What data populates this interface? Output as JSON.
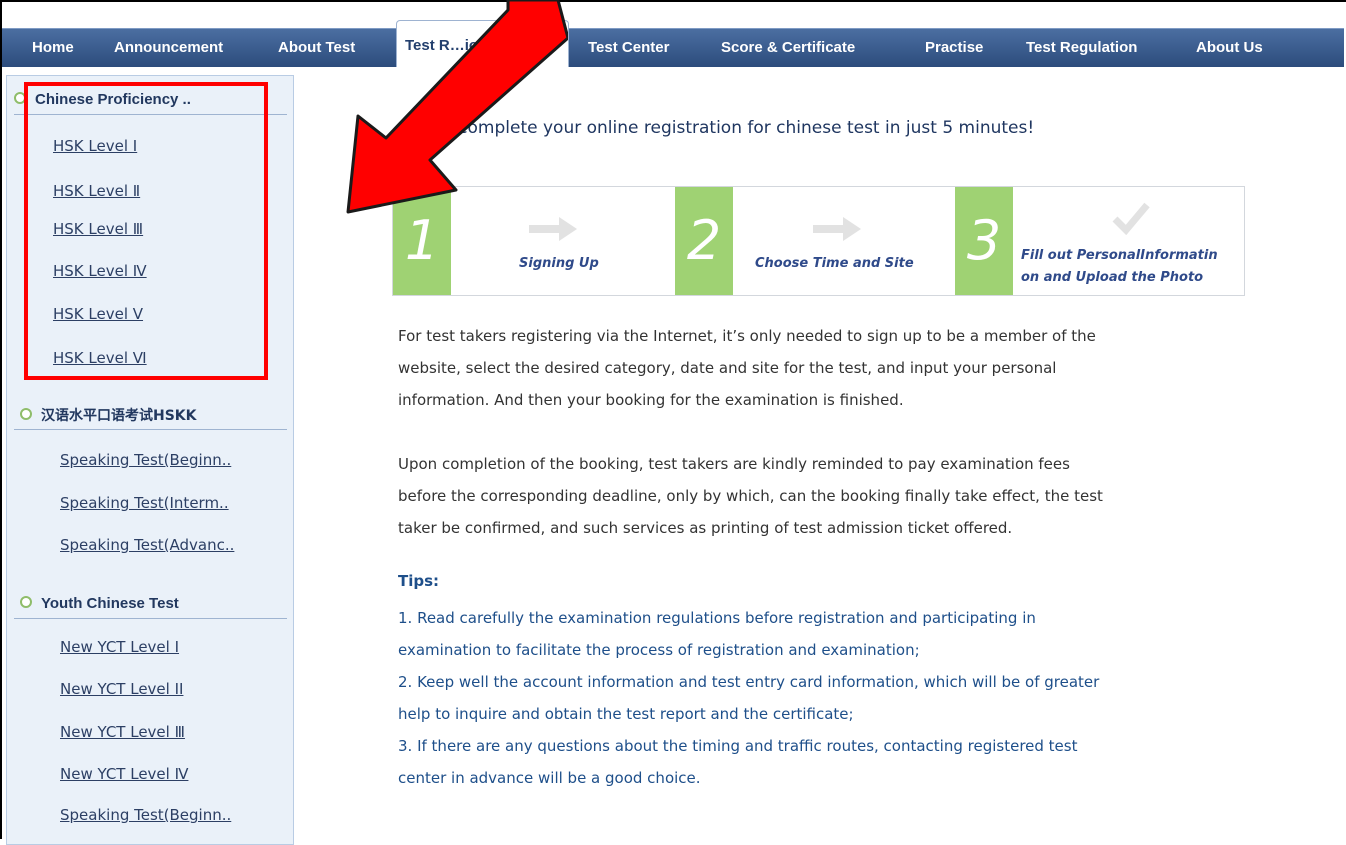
{
  "nav": {
    "items": [
      {
        "label": "Home"
      },
      {
        "label": "Announcement"
      },
      {
        "label": "About Test"
      },
      {
        "label": "Test Registration",
        "active": true
      },
      {
        "label": "Test Center"
      },
      {
        "label": "Score & Certificate"
      },
      {
        "label": "Practise"
      },
      {
        "label": "Test Regulation"
      },
      {
        "label": "About Us"
      }
    ],
    "active_visible_text": "Test R…ion"
  },
  "sidebar": {
    "sections": [
      {
        "title": "Chinese Proficiency ..",
        "items": [
          "HSK Level I",
          "HSK Level Ⅱ",
          "HSK Level Ⅲ",
          "HSK Level Ⅳ",
          "HSK Level V",
          "HSK Level Ⅵ"
        ]
      },
      {
        "title": "汉语水平口语考试HSKK",
        "items": [
          "Speaking Test(Beginn..",
          "Speaking Test(Interm..",
          "Speaking Test(Advanc.."
        ]
      },
      {
        "title": "Youth Chinese Test",
        "items": [
          "New YCT Level I",
          "New YCT Level II",
          "New YCT Level Ⅲ",
          "New YCT Level Ⅳ",
          "Speaking Test(Beginn.."
        ]
      }
    ]
  },
  "main": {
    "heading": "asily complete your online registration for chinese test in just 5 minutes!",
    "steps": [
      {
        "num": "1",
        "label": "Signing Up"
      },
      {
        "num": "2",
        "label": "Choose Time and Site"
      },
      {
        "num": "3",
        "label_line1": "Fill out PersonalInformatin",
        "label_line2": "on and Upload the Photo"
      }
    ],
    "para1": [
      "For test takers registering via the Internet, it’s only needed to sign up to be a member of the",
      "website, select the desired category, date and site for the test, and input your personal",
      "information. And then your booking for the examination is finished."
    ],
    "para2": [
      "Upon completion of the booking, test takers are kindly reminded to pay examination fees",
      "before the corresponding deadline, only by which, can the booking finally take effect, the test",
      "taker be confirmed, and such services as printing of test admission ticket offered."
    ],
    "tips_title": "Tips:",
    "tips": [
      "1. Read carefully the examination regulations before registration and participating in",
      "examination to facilitate the process of registration and examination;",
      "2. Keep well the account information and test entry card information, which will be of greater",
      "help to inquire and obtain the test report and the certificate;",
      "3. If there are any questions about the timing and traffic routes, contacting registered test",
      "center in advance will be a good choice."
    ]
  },
  "colors": {
    "nav_bg": "#2c4c7c",
    "step_green": "#9fd273",
    "annotation_red": "#ff0000",
    "tips_blue": "#1e4f8a"
  }
}
